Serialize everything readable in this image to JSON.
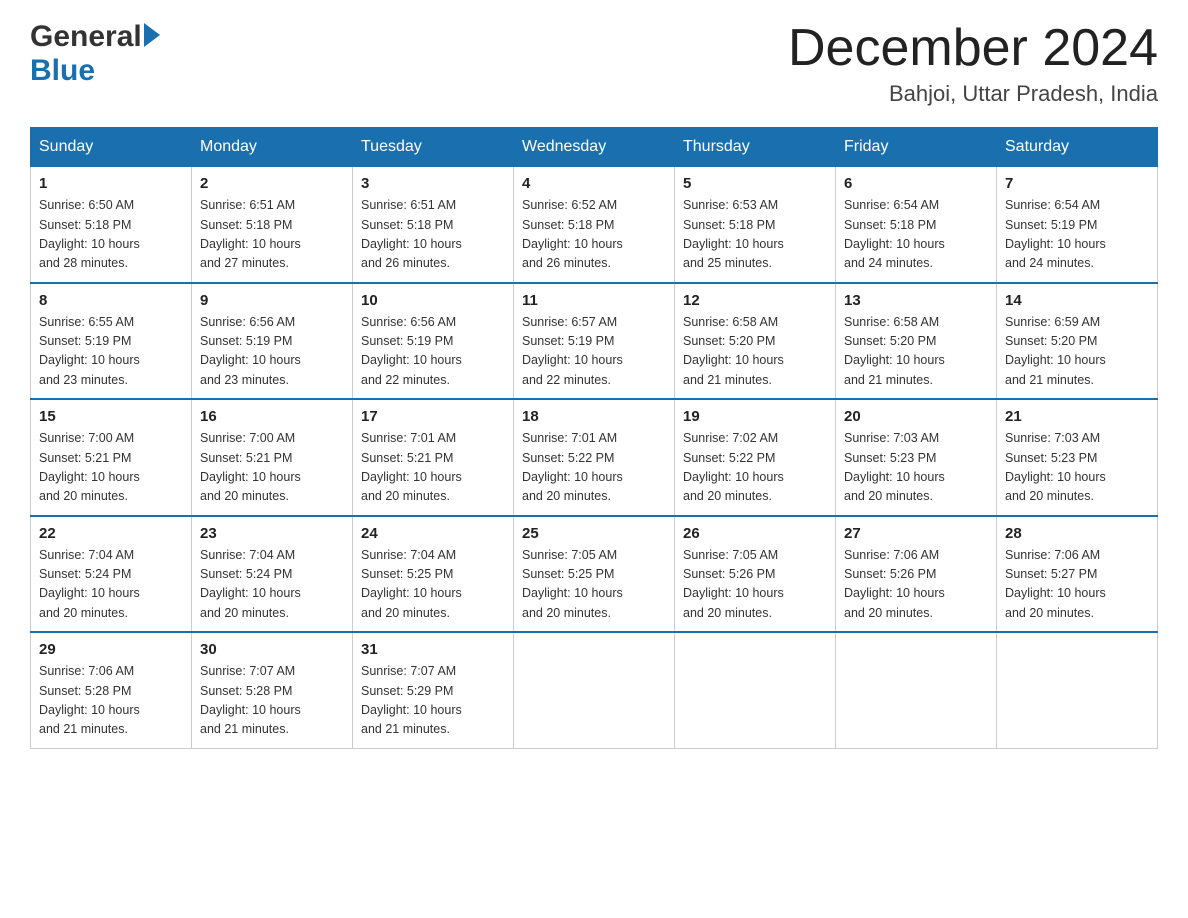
{
  "header": {
    "logo_general": "General",
    "logo_blue": "Blue",
    "month_title": "December 2024",
    "location": "Bahjoi, Uttar Pradesh, India"
  },
  "weekdays": [
    "Sunday",
    "Monday",
    "Tuesday",
    "Wednesday",
    "Thursday",
    "Friday",
    "Saturday"
  ],
  "weeks": [
    [
      {
        "day": "1",
        "sunrise": "6:50 AM",
        "sunset": "5:18 PM",
        "daylight": "10 hours and 28 minutes."
      },
      {
        "day": "2",
        "sunrise": "6:51 AM",
        "sunset": "5:18 PM",
        "daylight": "10 hours and 27 minutes."
      },
      {
        "day": "3",
        "sunrise": "6:51 AM",
        "sunset": "5:18 PM",
        "daylight": "10 hours and 26 minutes."
      },
      {
        "day": "4",
        "sunrise": "6:52 AM",
        "sunset": "5:18 PM",
        "daylight": "10 hours and 26 minutes."
      },
      {
        "day": "5",
        "sunrise": "6:53 AM",
        "sunset": "5:18 PM",
        "daylight": "10 hours and 25 minutes."
      },
      {
        "day": "6",
        "sunrise": "6:54 AM",
        "sunset": "5:18 PM",
        "daylight": "10 hours and 24 minutes."
      },
      {
        "day": "7",
        "sunrise": "6:54 AM",
        "sunset": "5:19 PM",
        "daylight": "10 hours and 24 minutes."
      }
    ],
    [
      {
        "day": "8",
        "sunrise": "6:55 AM",
        "sunset": "5:19 PM",
        "daylight": "10 hours and 23 minutes."
      },
      {
        "day": "9",
        "sunrise": "6:56 AM",
        "sunset": "5:19 PM",
        "daylight": "10 hours and 23 minutes."
      },
      {
        "day": "10",
        "sunrise": "6:56 AM",
        "sunset": "5:19 PM",
        "daylight": "10 hours and 22 minutes."
      },
      {
        "day": "11",
        "sunrise": "6:57 AM",
        "sunset": "5:19 PM",
        "daylight": "10 hours and 22 minutes."
      },
      {
        "day": "12",
        "sunrise": "6:58 AM",
        "sunset": "5:20 PM",
        "daylight": "10 hours and 21 minutes."
      },
      {
        "day": "13",
        "sunrise": "6:58 AM",
        "sunset": "5:20 PM",
        "daylight": "10 hours and 21 minutes."
      },
      {
        "day": "14",
        "sunrise": "6:59 AM",
        "sunset": "5:20 PM",
        "daylight": "10 hours and 21 minutes."
      }
    ],
    [
      {
        "day": "15",
        "sunrise": "7:00 AM",
        "sunset": "5:21 PM",
        "daylight": "10 hours and 20 minutes."
      },
      {
        "day": "16",
        "sunrise": "7:00 AM",
        "sunset": "5:21 PM",
        "daylight": "10 hours and 20 minutes."
      },
      {
        "day": "17",
        "sunrise": "7:01 AM",
        "sunset": "5:21 PM",
        "daylight": "10 hours and 20 minutes."
      },
      {
        "day": "18",
        "sunrise": "7:01 AM",
        "sunset": "5:22 PM",
        "daylight": "10 hours and 20 minutes."
      },
      {
        "day": "19",
        "sunrise": "7:02 AM",
        "sunset": "5:22 PM",
        "daylight": "10 hours and 20 minutes."
      },
      {
        "day": "20",
        "sunrise": "7:03 AM",
        "sunset": "5:23 PM",
        "daylight": "10 hours and 20 minutes."
      },
      {
        "day": "21",
        "sunrise": "7:03 AM",
        "sunset": "5:23 PM",
        "daylight": "10 hours and 20 minutes."
      }
    ],
    [
      {
        "day": "22",
        "sunrise": "7:04 AM",
        "sunset": "5:24 PM",
        "daylight": "10 hours and 20 minutes."
      },
      {
        "day": "23",
        "sunrise": "7:04 AM",
        "sunset": "5:24 PM",
        "daylight": "10 hours and 20 minutes."
      },
      {
        "day": "24",
        "sunrise": "7:04 AM",
        "sunset": "5:25 PM",
        "daylight": "10 hours and 20 minutes."
      },
      {
        "day": "25",
        "sunrise": "7:05 AM",
        "sunset": "5:25 PM",
        "daylight": "10 hours and 20 minutes."
      },
      {
        "day": "26",
        "sunrise": "7:05 AM",
        "sunset": "5:26 PM",
        "daylight": "10 hours and 20 minutes."
      },
      {
        "day": "27",
        "sunrise": "7:06 AM",
        "sunset": "5:26 PM",
        "daylight": "10 hours and 20 minutes."
      },
      {
        "day": "28",
        "sunrise": "7:06 AM",
        "sunset": "5:27 PM",
        "daylight": "10 hours and 20 minutes."
      }
    ],
    [
      {
        "day": "29",
        "sunrise": "7:06 AM",
        "sunset": "5:28 PM",
        "daylight": "10 hours and 21 minutes."
      },
      {
        "day": "30",
        "sunrise": "7:07 AM",
        "sunset": "5:28 PM",
        "daylight": "10 hours and 21 minutes."
      },
      {
        "day": "31",
        "sunrise": "7:07 AM",
        "sunset": "5:29 PM",
        "daylight": "10 hours and 21 minutes."
      },
      null,
      null,
      null,
      null
    ]
  ],
  "labels": {
    "sunrise_prefix": "Sunrise: ",
    "sunset_prefix": "Sunset: ",
    "daylight_prefix": "Daylight: "
  }
}
